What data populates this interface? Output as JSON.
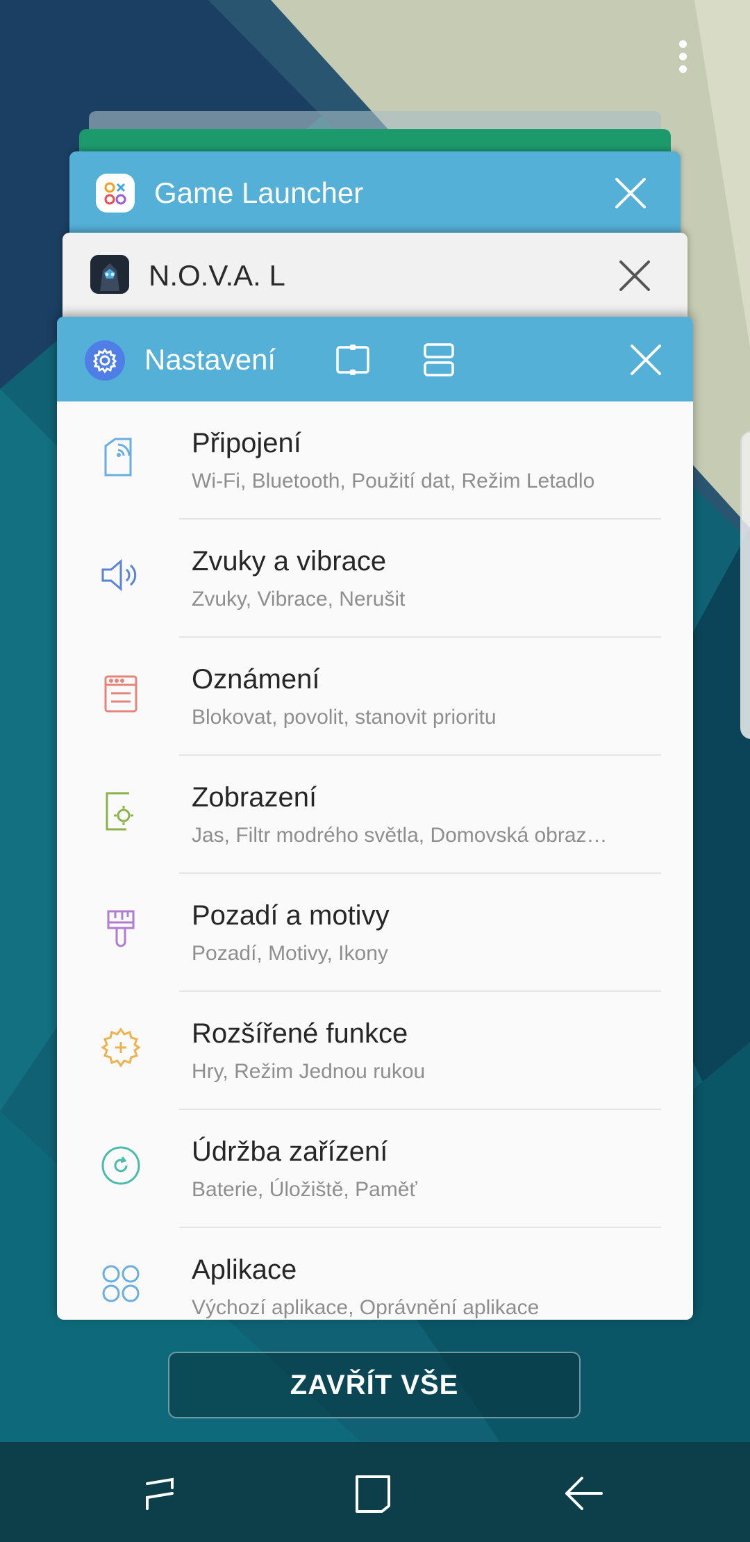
{
  "recents": {
    "cards": [
      {
        "title": "Game Launcher"
      },
      {
        "title": "N.O.V.A. L"
      }
    ],
    "active_card": {
      "title": "Nastavení"
    },
    "close_all_label": "ZAVŘÍT VŠE"
  },
  "settings": {
    "items": [
      {
        "title": "Připojení",
        "subtitle": "Wi-Fi, Bluetooth, Použití dat, Režim Letadlo",
        "icon": "connection-icon",
        "color": "#6aaee0"
      },
      {
        "title": "Zvuky a vibrace",
        "subtitle": "Zvuky, Vibrace, Nerušit",
        "icon": "speaker-icon",
        "color": "#5b84d6"
      },
      {
        "title": "Oznámení",
        "subtitle": "Blokovat, povolit, stanovit prioritu",
        "icon": "notification-icon",
        "color": "#e5847a"
      },
      {
        "title": "Zobrazení",
        "subtitle": "Jas, Filtr modrého světla, Domovská obraz…",
        "icon": "display-icon",
        "color": "#8cb24a"
      },
      {
        "title": "Pozadí a motivy",
        "subtitle": "Pozadí, Motivy, Ikony",
        "icon": "brush-icon",
        "color": "#b07cd0"
      },
      {
        "title": "Rozšířené funkce",
        "subtitle": "Hry, Režim Jednou rukou",
        "icon": "advanced-gear-icon",
        "color": "#f0b24e"
      },
      {
        "title": "Údržba zařízení",
        "subtitle": "Baterie, Úložiště, Paměť",
        "icon": "maintenance-icon",
        "color": "#4cbcaa"
      },
      {
        "title": "Aplikace",
        "subtitle": "Výchozí aplikace, Oprávnění aplikace",
        "icon": "apps-icon",
        "color": "#6aaee0"
      }
    ]
  },
  "colors": {
    "header_blue": "#54b0d6",
    "navbar": "#0c3f4a"
  }
}
